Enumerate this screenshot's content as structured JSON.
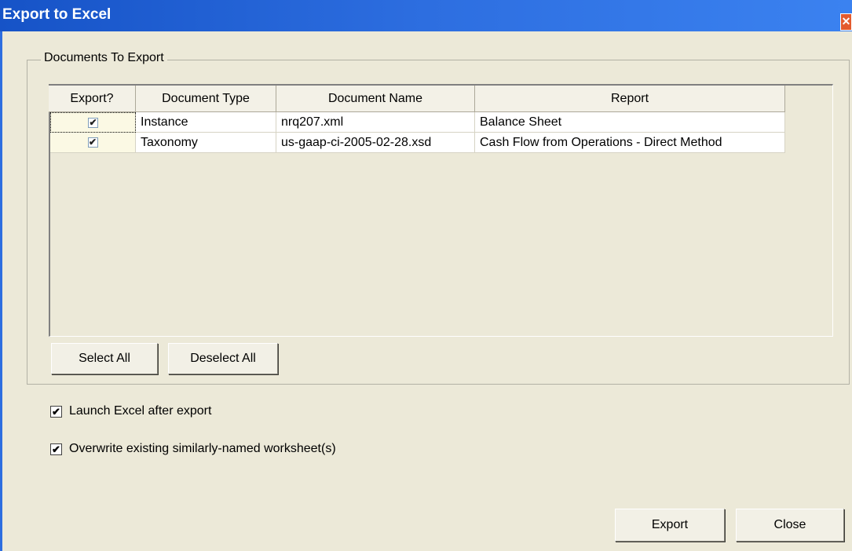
{
  "window": {
    "title": "Export to Excel",
    "close_glyph": "✕"
  },
  "group": {
    "legend": "Documents To Export"
  },
  "table": {
    "columns": [
      "Export?",
      "Document Type",
      "Document Name",
      "Report"
    ],
    "rows": [
      {
        "export": true,
        "type": "Instance",
        "name": "nrq207.xml",
        "report": "Balance Sheet"
      },
      {
        "export": true,
        "type": "Taxonomy",
        "name": "us-gaap-ci-2005-02-28.xsd",
        "report": "Cash Flow from Operations - Direct Method"
      }
    ]
  },
  "buttons": {
    "select_all": "Select All",
    "deselect_all": "Deselect All",
    "export": "Export",
    "close": "Close"
  },
  "options": {
    "launch_excel": {
      "label": "Launch Excel after export",
      "checked": true
    },
    "overwrite": {
      "label": "Overwrite existing similarly-named worksheet(s)",
      "checked": true
    }
  },
  "icons": {
    "check_glyph": "✔"
  },
  "colors": {
    "titlebar": "#2d6ee0",
    "dialog_bg": "#ece9d8",
    "close_button": "#e35a2e"
  }
}
